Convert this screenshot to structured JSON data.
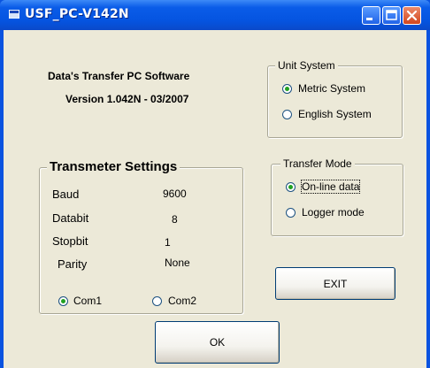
{
  "window": {
    "title": "USF_PC-V142N"
  },
  "header": {
    "line1": "Data's Transfer PC Software",
    "line2": "Version 1.042N - 03/2007"
  },
  "unit_system": {
    "legend": "Unit System",
    "options": [
      {
        "label": "Metric System",
        "selected": true
      },
      {
        "label": "English System",
        "selected": false
      }
    ]
  },
  "transfer_mode": {
    "legend": "Transfer Mode",
    "options": [
      {
        "label": "On-line data",
        "selected": true
      },
      {
        "label": "Logger mode",
        "selected": false
      }
    ]
  },
  "transmeter": {
    "legend": "Transmeter Settings",
    "rows": [
      {
        "label": "Baud",
        "value": "9600"
      },
      {
        "label": "Databit",
        "value": "8"
      },
      {
        "label": "Stopbit",
        "value": "1"
      },
      {
        "label": "Parity",
        "value": "None"
      }
    ],
    "ports": [
      {
        "label": "Com1",
        "selected": true
      },
      {
        "label": "Com2",
        "selected": false
      }
    ]
  },
  "buttons": {
    "exit": "EXIT",
    "ok": "OK"
  }
}
